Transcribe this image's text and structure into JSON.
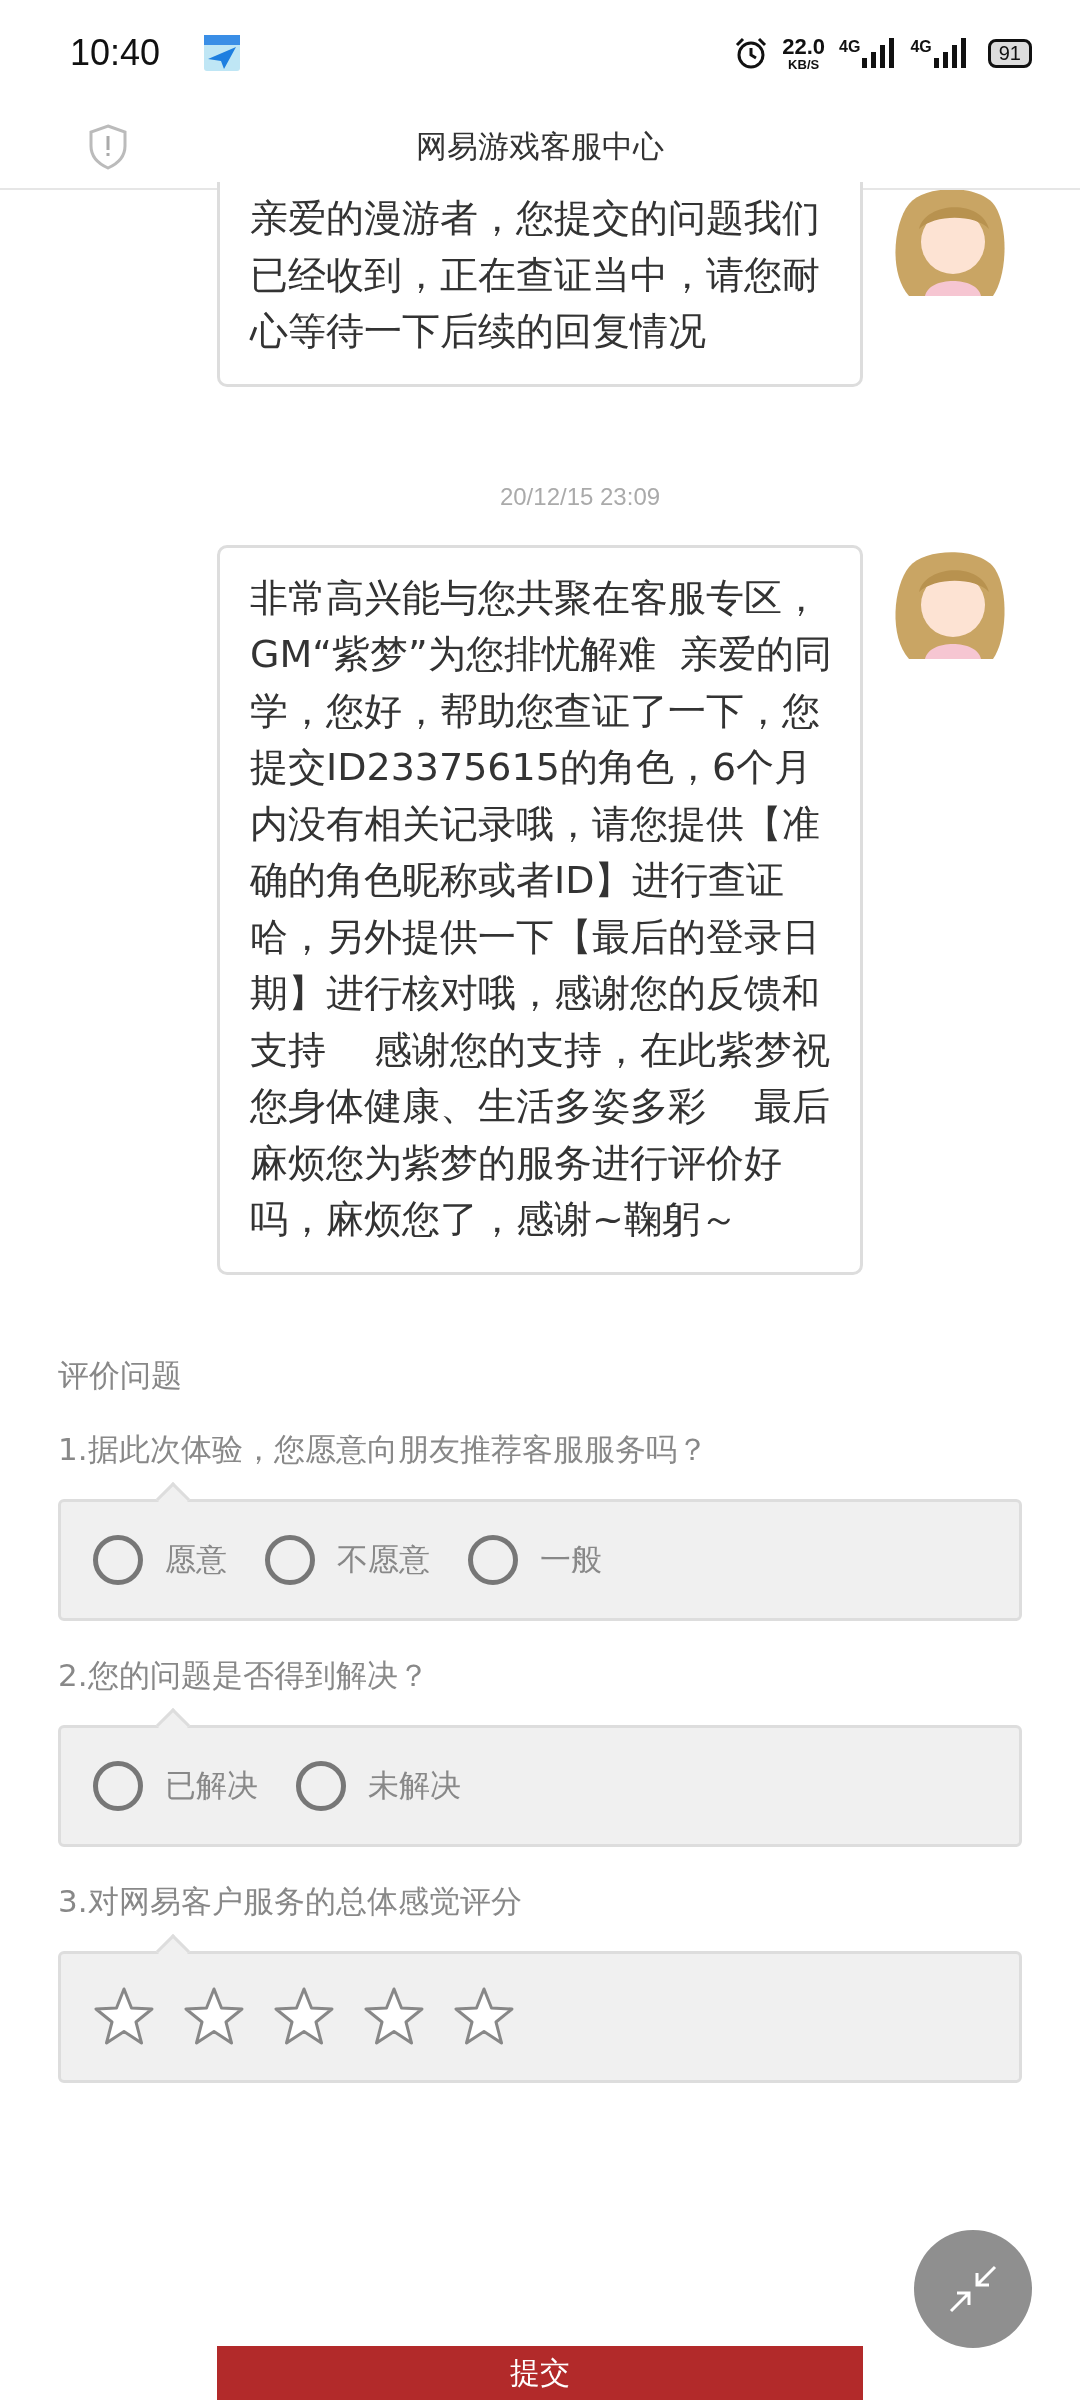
{
  "status_bar": {
    "time": "10:40",
    "speed": "22.0",
    "speed_unit": "KB/S",
    "network_1": "4G",
    "network_2": "4G",
    "battery": "91"
  },
  "header": {
    "title": "网易游戏客服中心"
  },
  "messages": [
    {
      "kind": "message",
      "text": "亲爱的漫游者，您提交的问题我们已经收到，正在查证当中，请您耐心等待一下后续的回复情况"
    },
    {
      "kind": "time",
      "text": "20/12/15 23:09"
    },
    {
      "kind": "message",
      "text": "非常高兴能与您共聚在客服专区，GM“紫梦”为您排忧解难  亲爱的同学，您好，帮助您查证了一下，您提交ID23375615的角色，6个月内没有相关记录哦，请您提供【准确的角色昵称或者ID】进行查证哈，另外提供一下【最后的登录日期】进行核对哦，感谢您的反馈和支持    感谢您的支持，在此紫梦祝您身体健康、生活多姿多彩    最后麻烦您为紫梦的服务进行评价好吗，麻烦您了，感谢~鞠躬～"
    }
  ],
  "evaluation": {
    "title": "评价问题",
    "questions": [
      {
        "kind": "choice",
        "label": "1.据此次体验，您愿意向朋友推荐客服服务吗？",
        "options": [
          {
            "label": "愿意",
            "selected": false
          },
          {
            "label": "不愿意",
            "selected": false
          },
          {
            "label": "一般",
            "selected": false
          }
        ]
      },
      {
        "kind": "choice",
        "label": "2.您的问题是否得到解决？",
        "options": [
          {
            "label": "已解决",
            "selected": false
          },
          {
            "label": "未解决",
            "selected": false
          }
        ]
      },
      {
        "kind": "rating",
        "label": "3.对网易客户服务的总体感觉评分",
        "stars": 0
      }
    ]
  },
  "submit_button": {
    "label": "提交"
  }
}
